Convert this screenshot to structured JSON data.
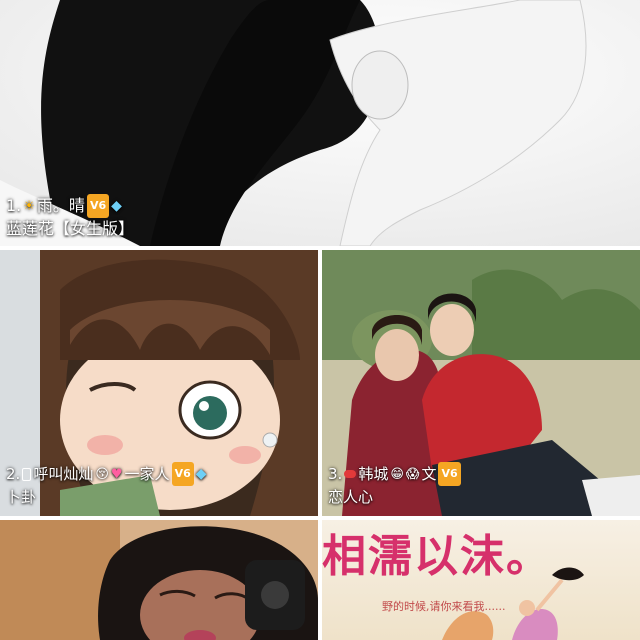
{
  "cards": [
    {
      "rank": "1.",
      "name": "雨。晴",
      "subtitle": "蓝莲花【女生版】",
      "icons": [
        "sun-icon",
        "vip-badge-icon",
        "diamond-icon"
      ],
      "vip_label": "V6"
    },
    {
      "rank": "2.",
      "name_a": "呼叫灿灿",
      "name_b": "一家人",
      "subtitle": "卜卦",
      "icons": [
        "phone-icon",
        "kiss-face-icon",
        "heart-icon",
        "vip-badge-icon",
        "diamond-icon"
      ],
      "vip_label": "V6"
    },
    {
      "rank": "3.",
      "name_a": "韩城",
      "name_b": "文",
      "subtitle": "恋人心",
      "icons": [
        "red-dot-icon",
        "grin-face-icon",
        "scream-face-icon",
        "vip-badge-icon"
      ],
      "vip_label": "V6"
    },
    {
      "rank": "",
      "subtitle": ""
    },
    {
      "poster_title": "相濡以沫。",
      "poster_subtitle": "野的时候,请你来看我......"
    }
  ],
  "colors": {
    "background": "#ffffff",
    "caption_text": "#ffffff",
    "vip_badge": "#f5a623",
    "diamond": "#6ed0f7",
    "poster_title": "#d6306b"
  }
}
